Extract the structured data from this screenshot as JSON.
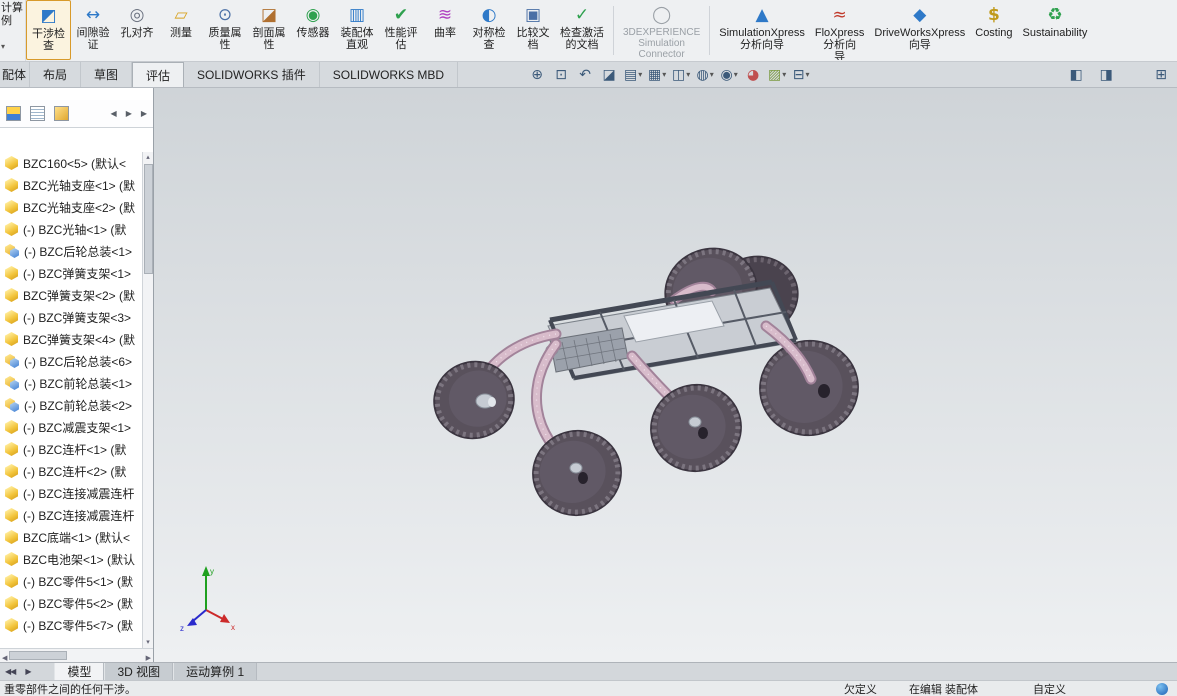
{
  "colors": {
    "vp-top": "#cfd4d8",
    "vp-bottom": "#eef0f2",
    "wheel": "#59515c",
    "wheel-dark": "#3b3540",
    "wheel-face": "#615966",
    "tread": "#837b86",
    "hub-hole": "#27222c",
    "arm": "#d8bccb",
    "arm-edge": "#a2839a",
    "arm-dot": "#efe2ea",
    "chassis": "#c9cdd3",
    "chassis-dark": "#434854",
    "panel": "#edeff3",
    "perf": "#9ba1ab",
    "triad-x": "#cc2a2a",
    "triad-y": "#1fa01f",
    "triad-z": "#2a2acc",
    "accent": "#2d7dd2"
  },
  "ribbon": {
    "cut": {
      "line1": "计算",
      "line2": "例"
    },
    "group1": [
      {
        "name": "interference-check-button",
        "icon": "ic-interference",
        "icon_name": "interference-check-icon",
        "label": "干涉检\n查",
        "mods": "highlighted"
      },
      {
        "name": "clearance-verification-button",
        "icon": "ic-clearance",
        "icon_name": "clearance-verification-icon",
        "label": "间隙验\n证",
        "mods": ""
      },
      {
        "name": "hole-alignment-button",
        "icon": "ic-hole",
        "icon_name": "hole-alignment-icon",
        "label": "孔对齐",
        "mods": ""
      },
      {
        "name": "measure-button",
        "icon": "ic-measure",
        "icon_name": "measure-icon",
        "label": "测量",
        "mods": ""
      },
      {
        "name": "mass-properties-button",
        "icon": "ic-mass",
        "icon_name": "mass-properties-icon",
        "label": "质量属\n性",
        "mods": ""
      },
      {
        "name": "section-properties-button",
        "icon": "ic-sectionprops",
        "icon_name": "section-properties-icon",
        "label": "剖面属\n性",
        "mods": ""
      },
      {
        "name": "sensors-button",
        "icon": "ic-sensors",
        "icon_name": "sensor-icon",
        "label": "传感器",
        "mods": ""
      },
      {
        "name": "assembly-visualization-button",
        "icon": "ic-asmvis",
        "icon_name": "assembly-visualization-icon",
        "label": "装配体\n直观",
        "mods": ""
      },
      {
        "name": "performance-evaluation-button",
        "icon": "ic-perf",
        "icon_name": "performance-evaluation-icon",
        "label": "性能评\n估",
        "mods": ""
      },
      {
        "name": "curvature-button",
        "icon": "ic-curvature",
        "icon_name": "curvature-icon",
        "label": "曲率",
        "mods": ""
      },
      {
        "name": "symmetry-check-button",
        "icon": "ic-symmetry",
        "icon_name": "symmetry-check-icon",
        "label": "对称检\n查",
        "mods": ""
      },
      {
        "name": "compare-documents-button",
        "icon": "ic-compare",
        "icon_name": "compare-documents-icon",
        "label": "比较文\n档",
        "mods": ""
      },
      {
        "name": "check-active-document-button",
        "icon": "ic-checkactive",
        "icon_name": "check-active-document-icon",
        "label": "检查激活\n的文档",
        "mods": ""
      }
    ],
    "group2": [
      {
        "name": "3dexperience-simulation-connector-button",
        "icon": "ic-3dx",
        "icon_name": "3dexperience-icon",
        "label": "3DEXPERIENCE\nSimulation\nConnector",
        "mods": "disabled"
      }
    ],
    "group3": [
      {
        "name": "simulationxpress-wizard-button",
        "icon": "ic-simx",
        "icon_name": "simulationxpress-icon",
        "label": "SimulationXpress\n分析向导",
        "mods": ""
      },
      {
        "name": "floxpress-wizard-button",
        "icon": "ic-flox",
        "icon_name": "floxpress-icon",
        "label": "FloXpress\n分析向\n导",
        "mods": ""
      },
      {
        "name": "driveworksxpress-wizard-button",
        "icon": "ic-dwx",
        "icon_name": "driveworksxpress-icon",
        "label": "DriveWorksXpress\n向导",
        "mods": ""
      },
      {
        "name": "costing-button",
        "icon": "ic-costing",
        "icon_name": "costing-icon",
        "label": "Costing",
        "mods": ""
      },
      {
        "name": "sustainability-button",
        "icon": "ic-sustain",
        "icon_name": "sustainability-icon",
        "label": "Sustainability",
        "mods": ""
      }
    ]
  },
  "tabs": {
    "items": [
      {
        "name": "tab-assembly",
        "label": "配体",
        "mods": "cut"
      },
      {
        "name": "tab-layout",
        "label": "布局",
        "mods": ""
      },
      {
        "name": "tab-sketch",
        "label": "草图",
        "mods": ""
      },
      {
        "name": "tab-evaluate",
        "label": "评估",
        "mods": "active"
      },
      {
        "name": "tab-solidworks-addins",
        "label": "SOLIDWORKS 插件",
        "mods": ""
      },
      {
        "name": "tab-solidworks-mbd",
        "label": "SOLIDWORKS MBD",
        "mods": ""
      }
    ]
  },
  "headsup": {
    "icons": [
      {
        "name": "zoom-fit-icon",
        "cls": "g-zoomfit"
      },
      {
        "name": "zoom-area-icon",
        "cls": "g-zoomarea"
      },
      {
        "name": "previous-view-icon",
        "cls": "g-prevview"
      },
      {
        "name": "section-view-icon",
        "cls": "g-section"
      },
      {
        "name": "annotation-views-icon",
        "cls": "g-annot has-caret"
      },
      {
        "name": "view-selector-icon",
        "cls": "g-viewsel has-caret"
      },
      {
        "name": "view-orientation-icon",
        "cls": "g-orient has-caret"
      },
      {
        "name": "display-style-icon",
        "cls": "g-dispstyle has-caret"
      },
      {
        "name": "hide-show-items-icon",
        "cls": "g-hideshow has-caret"
      },
      {
        "name": "edit-appearance-icon",
        "cls": "g-appearance"
      },
      {
        "name": "apply-scene-icon",
        "cls": "g-scene has-caret"
      },
      {
        "name": "view-settings-icon",
        "cls": "g-viewset has-caret"
      }
    ]
  },
  "tree": {
    "items": [
      {
        "icon": "part-icon",
        "icon_name": "part-icon",
        "label": "BZC160<5> (默认<"
      },
      {
        "icon": "part-icon",
        "icon_name": "part-icon",
        "label": "BZC光轴支座<1> (默"
      },
      {
        "icon": "part-icon",
        "icon_name": "part-icon",
        "label": "BZC光轴支座<2> (默"
      },
      {
        "icon": "part-icon",
        "icon_name": "part-icon",
        "label": "(-) BZC光轴<1> (默"
      },
      {
        "icon": "asm-icon",
        "icon_name": "assembly-icon",
        "label": "(-) BZC后轮总装<1>"
      },
      {
        "icon": "part-icon",
        "icon_name": "part-icon",
        "label": "(-) BZC弹簧支架<1>"
      },
      {
        "icon": "part-icon",
        "icon_name": "part-icon",
        "label": "BZC弹簧支架<2> (默"
      },
      {
        "icon": "part-icon",
        "icon_name": "part-icon",
        "label": "(-) BZC弹簧支架<3>"
      },
      {
        "icon": "part-icon",
        "icon_name": "part-icon",
        "label": "BZC弹簧支架<4> (默"
      },
      {
        "icon": "asm-icon",
        "icon_name": "assembly-icon",
        "label": "(-) BZC后轮总装<6>"
      },
      {
        "icon": "asm-icon",
        "icon_name": "assembly-icon",
        "label": "(-) BZC前轮总装<1>"
      },
      {
        "icon": "asm-icon",
        "icon_name": "assembly-icon",
        "label": "(-) BZC前轮总装<2>"
      },
      {
        "icon": "part-icon",
        "icon_name": "part-icon",
        "label": "(-) BZC减震支架<1>"
      },
      {
        "icon": "part-icon",
        "icon_name": "part-icon",
        "label": "(-) BZC连杆<1> (默"
      },
      {
        "icon": "part-icon",
        "icon_name": "part-icon",
        "label": "(-) BZC连杆<2> (默"
      },
      {
        "icon": "part-icon",
        "icon_name": "part-icon",
        "label": "(-) BZC连接减震连杆"
      },
      {
        "icon": "part-icon",
        "icon_name": "part-icon",
        "label": "(-) BZC连接减震连杆"
      },
      {
        "icon": "part-icon",
        "icon_name": "part-icon",
        "label": "BZC底端<1> (默认<"
      },
      {
        "icon": "part-icon",
        "icon_name": "part-icon",
        "label": "BZC电池架<1> (默认"
      },
      {
        "icon": "part-icon",
        "icon_name": "part-icon",
        "label": "(-) BZC零件5<1> (默"
      },
      {
        "icon": "part-icon",
        "icon_name": "part-icon",
        "label": "(-) BZC零件5<2> (默"
      },
      {
        "icon": "part-icon",
        "icon_name": "part-icon",
        "label": "(-) BZC零件5<7> (默"
      }
    ]
  },
  "bottom_tabs": {
    "items": [
      {
        "name": "tab-model",
        "label": "模型",
        "mods": "active"
      },
      {
        "name": "tab-3d-views",
        "label": "3D 视图",
        "mods": ""
      },
      {
        "name": "tab-motion-study-1",
        "label": "运动算例 1",
        "mods": ""
      }
    ]
  },
  "statusbar": {
    "message": "重零部件之间的任何干涉。",
    "define_state": "欠定义",
    "edit_state": "在编辑 装配体",
    "custom": "自定义"
  }
}
